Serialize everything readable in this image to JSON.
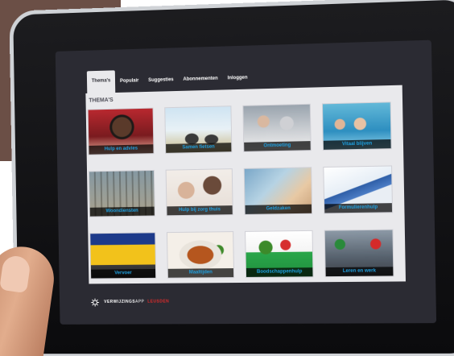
{
  "tabs": [
    {
      "label": "Thema's",
      "active": true
    },
    {
      "label": "Populair",
      "active": false
    },
    {
      "label": "Suggesties",
      "active": false
    },
    {
      "label": "Abonnementen",
      "active": false
    },
    {
      "label": "Inloggen",
      "active": false
    }
  ],
  "section": {
    "title": "THEMA'S"
  },
  "tiles": [
    {
      "label": "Hulp en advies",
      "scene": "woman-portrait"
    },
    {
      "label": "Samen fietsen",
      "scene": "cyclists"
    },
    {
      "label": "Ontmoeting",
      "scene": "people-table"
    },
    {
      "label": "Vitaal blijven",
      "scene": "pool"
    },
    {
      "label": "Woondiensten",
      "scene": "housing"
    },
    {
      "label": "Hulp bij zorg thuis",
      "scene": "care"
    },
    {
      "label": "Geldzaken",
      "scene": "money"
    },
    {
      "label": "Formulierenhulp",
      "scene": "forms"
    },
    {
      "label": "Vervoer",
      "scene": "train"
    },
    {
      "label": "Maaltijden",
      "scene": "meal"
    },
    {
      "label": "Boodschappenhulp",
      "scene": "groceries"
    },
    {
      "label": "Leren en werk",
      "scene": "workers"
    }
  ],
  "footer": {
    "brand_part1": "VERWIJZINGS",
    "brand_part2": "APP",
    "brand_part3": "LEUSDEN"
  },
  "colors": {
    "caption_text": "#1fa0e0",
    "screen_bg": "#2b2b33",
    "content_bg": "#e9e9ec",
    "brand_accent": "#e22b2b"
  },
  "icons": {
    "footer_logo": "gear-icon"
  }
}
